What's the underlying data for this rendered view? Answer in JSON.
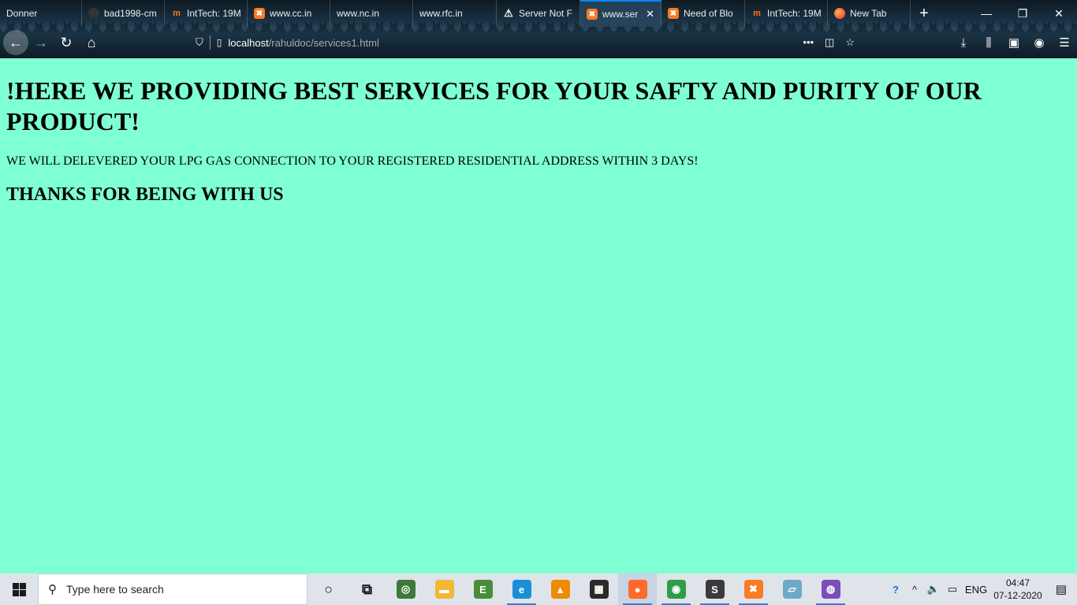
{
  "browser": {
    "tabs": [
      {
        "label": "Donner",
        "favicon": "none",
        "width": 104
      },
      {
        "label": "bad1998-cm",
        "favicon": "github-icon",
        "width": 105
      },
      {
        "label": "IntTech: 19M",
        "favicon": "inttech-icon",
        "width": 105
      },
      {
        "label": "www.cc.in",
        "favicon": "xampp-icon",
        "width": 105
      },
      {
        "label": "www.nc.in",
        "favicon": "none",
        "width": 105
      },
      {
        "label": "www.rfc.in",
        "favicon": "none",
        "width": 106
      },
      {
        "label": "Server Not F",
        "favicon": "warning-icon",
        "width": 106
      },
      {
        "label": "www.ser",
        "favicon": "xampp-icon",
        "active": true,
        "width": 103
      },
      {
        "label": "Need of Blo",
        "favicon": "xampp-icon",
        "width": 106
      },
      {
        "label": "IntTech: 19M",
        "favicon": "inttech-icon",
        "width": 105
      },
      {
        "label": "New Tab",
        "favicon": "firefox-icon",
        "width": 105
      }
    ],
    "active_tab_close": "✕",
    "new_tab_glyph": "+",
    "window_controls": {
      "minimize": "—",
      "restore": "❐",
      "close": "✕"
    },
    "nav": {
      "back": "←",
      "forward": "→",
      "reload": "↻",
      "home": "⌂"
    },
    "url": {
      "host": "localhost",
      "path": "/rahuldoc/services1.html"
    },
    "url_actions": {
      "more": "•••",
      "pocket": "◫",
      "bookmark": "☆"
    },
    "toolbar": {
      "downloads": "⤓",
      "library": "⫼",
      "sidebar": "▣",
      "account": "◉",
      "menu": "☰"
    }
  },
  "page": {
    "heading": "!HERE WE PROVIDING BEST SERVICES FOR YOUR SAFTY AND PURITY OF OUR PRODUCT!",
    "paragraph": "WE WILL DELEVERED YOUR LPG GAS CONNECTION TO YOUR REGISTERED RESIDENTIAL ADDRESS WITHIN 3 DAYS!",
    "subheading": "THANKS FOR BEING WITH US",
    "background_color": "#7fffd4"
  },
  "taskbar": {
    "search_placeholder": "Type here to search",
    "apps": [
      {
        "name": "cortana-icon",
        "glyph": "○",
        "color": "transparent",
        "fg": "#111"
      },
      {
        "name": "task-view-icon",
        "glyph": "⧉",
        "color": "transparent",
        "fg": "#111"
      },
      {
        "name": "tripadvisor-icon",
        "glyph": "◎",
        "color": "#3d7a3a"
      },
      {
        "name": "file-explorer-icon",
        "glyph": "▬",
        "color": "#f2b833"
      },
      {
        "name": "evernote-icon",
        "glyph": "E",
        "color": "#4a8c3a"
      },
      {
        "name": "edge-icon",
        "glyph": "e",
        "color": "#1a8fd8",
        "running": true
      },
      {
        "name": "vlc-icon",
        "glyph": "▲",
        "color": "#f08a00"
      },
      {
        "name": "store-icon",
        "glyph": "▦",
        "color": "#2a2a2a"
      },
      {
        "name": "firefox-icon",
        "glyph": "●",
        "color": "#ff6a2a",
        "running": true,
        "focused": true
      },
      {
        "name": "chrome-icon",
        "glyph": "◉",
        "color": "#2e9d4a",
        "running": true
      },
      {
        "name": "sublime-icon",
        "glyph": "S",
        "color": "#3a3a3a",
        "running": true
      },
      {
        "name": "xampp-icon",
        "glyph": "✖",
        "color": "#fb7a24",
        "running": true
      },
      {
        "name": "notepad-icon",
        "glyph": "▱",
        "color": "#6fa8c9"
      },
      {
        "name": "discord-icon",
        "glyph": "◍",
        "color": "#7b4fb8",
        "running": true
      }
    ],
    "tray": {
      "help": "?",
      "chevron": "^",
      "volume": "🔈",
      "battery": "▭",
      "language": "ENG",
      "time": "04:47",
      "date": "07-12-2020",
      "notifications": "▤"
    }
  }
}
